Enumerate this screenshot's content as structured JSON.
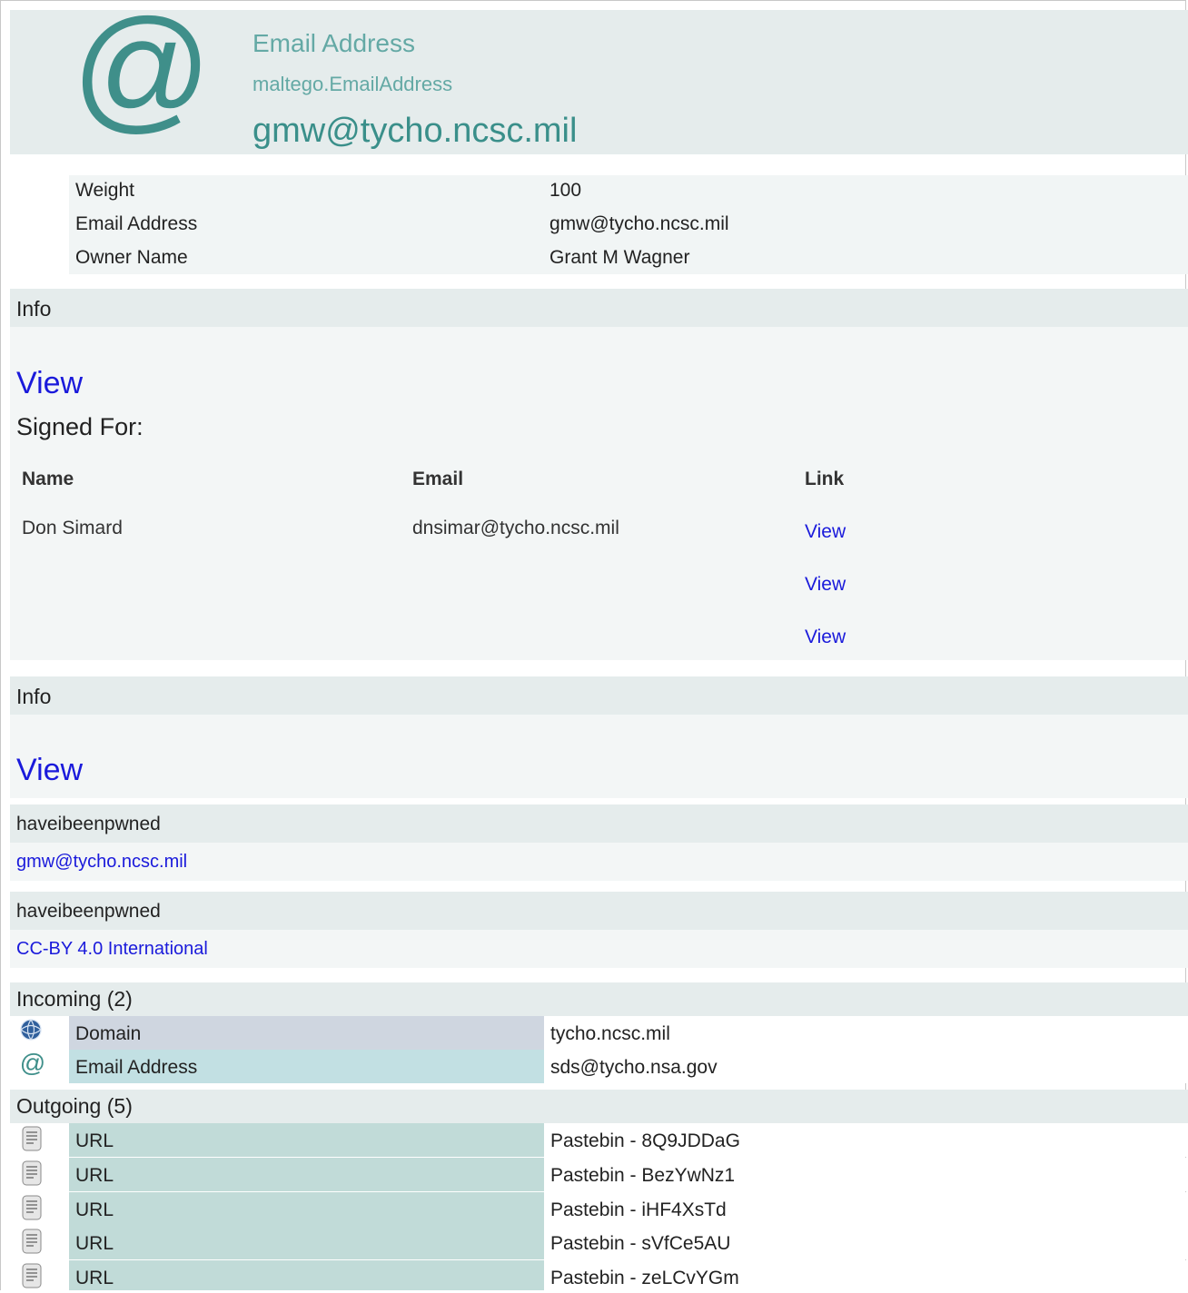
{
  "header": {
    "icon": "at-sign-icon",
    "entity_type": "Email Address",
    "entity_name": "maltego.EmailAddress",
    "entity_value": "gmw@tycho.ncsc.mil"
  },
  "properties": [
    {
      "key": "Weight",
      "value": "100"
    },
    {
      "key": "Email Address",
      "value": "gmw@tycho.ncsc.mil"
    },
    {
      "key": "Owner Name",
      "value": "Grant M Wagner"
    }
  ],
  "info1": {
    "title": "Info",
    "view_link": "View",
    "signed_for": "Signed For:",
    "table_headers": [
      "Name",
      "Email",
      "Link"
    ],
    "rows": [
      {
        "name": "Don Simard",
        "email": "dnsimar@tycho.ncsc.mil",
        "link": "View"
      },
      {
        "name": "",
        "email": "",
        "link": "View"
      },
      {
        "name": "",
        "email": "",
        "link": "View"
      }
    ]
  },
  "info2": {
    "title": "Info",
    "view_link": "View"
  },
  "hibp1": {
    "title": "haveibeenpwned",
    "link": "gmw@tycho.ncsc.mil"
  },
  "hibp2": {
    "title": "haveibeenpwned",
    "link": "CC-BY 4.0 International"
  },
  "incoming": {
    "title": "Incoming (2)",
    "items": [
      {
        "icon": "globe-domain-icon",
        "type": "Domain",
        "value": "tycho.ncsc.mil",
        "color": "#cfd6e0"
      },
      {
        "icon": "at-sign-icon",
        "type": "Email Address",
        "value": "sds@tycho.nsa.gov",
        "color": "#c2e0e3"
      }
    ]
  },
  "outgoing": {
    "title": "Outgoing (5)",
    "items": [
      {
        "icon": "url-icon",
        "type": "URL",
        "value": "Pastebin - 8Q9JDDaG",
        "color": "#c1dbd8"
      },
      {
        "icon": "url-icon",
        "type": "URL",
        "value": "Pastebin - BezYwNz1",
        "color": "#c1dbd8"
      },
      {
        "icon": "url-icon",
        "type": "URL",
        "value": "Pastebin - iHF4XsTd",
        "color": "#c1dbd8"
      },
      {
        "icon": "url-icon",
        "type": "URL",
        "value": "Pastebin - sVfCe5AU",
        "color": "#c1dbd8"
      },
      {
        "icon": "url-icon",
        "type": "URL",
        "value": "Pastebin - zeLCvYGm",
        "color": "#c1dbd8"
      }
    ]
  }
}
